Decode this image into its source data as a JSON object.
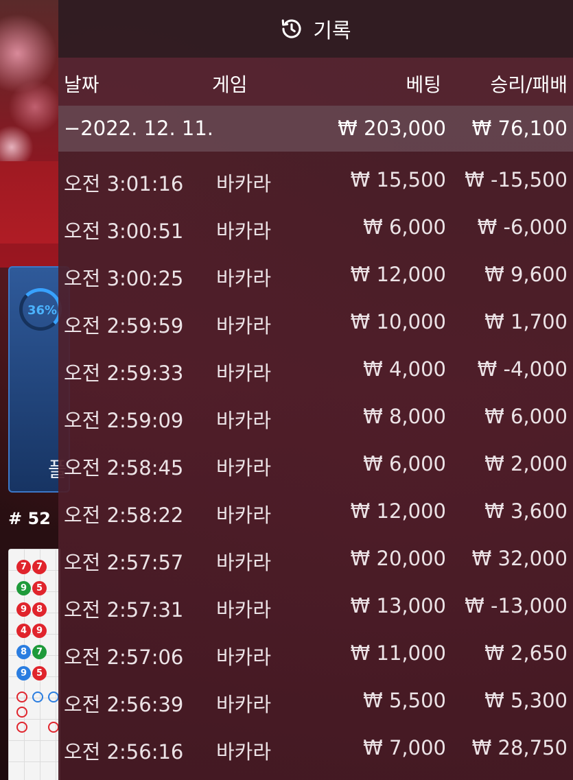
{
  "background": {
    "progress_percent_label": "36%",
    "progress_caption": "플",
    "round_label": "# 52",
    "beads": [
      {
        "label": "7",
        "color": "red"
      },
      {
        "label": "7",
        "color": "red"
      },
      {
        "label": "9",
        "color": "green"
      },
      {
        "label": "5",
        "color": "red"
      },
      {
        "label": "9",
        "color": "red"
      },
      {
        "label": "8",
        "color": "red"
      },
      {
        "label": "4",
        "color": "red"
      },
      {
        "label": "9",
        "color": "red"
      },
      {
        "label": "8",
        "color": "blue"
      },
      {
        "label": "7",
        "color": "green"
      },
      {
        "label": "9",
        "color": "blue"
      },
      {
        "label": "5",
        "color": "red"
      }
    ]
  },
  "panel": {
    "title": "기록",
    "title_icon": "history-icon",
    "columns": {
      "date": "날짜",
      "game": "게임",
      "bet": "베팅",
      "result": "승리/패배"
    },
    "date_group": {
      "date": "−2022. 12. 11.",
      "total_bet": "₩ 203,000",
      "total_result": "₩ 76,100"
    },
    "rows": [
      {
        "time": "오전 3:01:16",
        "game": "바카라",
        "bet": "₩ 15,500",
        "result": "₩ -15,500"
      },
      {
        "time": "오전 3:00:51",
        "game": "바카라",
        "bet": "₩ 6,000",
        "result": "₩ -6,000"
      },
      {
        "time": "오전 3:00:25",
        "game": "바카라",
        "bet": "₩ 12,000",
        "result": "₩ 9,600"
      },
      {
        "time": "오전 2:59:59",
        "game": "바카라",
        "bet": "₩ 10,000",
        "result": "₩ 1,700"
      },
      {
        "time": "오전 2:59:33",
        "game": "바카라",
        "bet": "₩ 4,000",
        "result": "₩ -4,000"
      },
      {
        "time": "오전 2:59:09",
        "game": "바카라",
        "bet": "₩ 8,000",
        "result": "₩ 6,000"
      },
      {
        "time": "오전 2:58:45",
        "game": "바카라",
        "bet": "₩ 6,000",
        "result": "₩ 2,000"
      },
      {
        "time": "오전 2:58:22",
        "game": "바카라",
        "bet": "₩ 12,000",
        "result": "₩ 3,600"
      },
      {
        "time": "오전 2:57:57",
        "game": "바카라",
        "bet": "₩ 20,000",
        "result": "₩ 32,000"
      },
      {
        "time": "오전 2:57:31",
        "game": "바카라",
        "bet": "₩ 13,000",
        "result": "₩ -13,000"
      },
      {
        "time": "오전 2:57:06",
        "game": "바카라",
        "bet": "₩ 11,000",
        "result": "₩ 2,650"
      },
      {
        "time": "오전 2:56:39",
        "game": "바카라",
        "bet": "₩ 5,500",
        "result": "₩ 5,300"
      },
      {
        "time": "오전 2:56:16",
        "game": "바카라",
        "bet": "₩ 7,000",
        "result": "₩ 28,750"
      }
    ]
  }
}
